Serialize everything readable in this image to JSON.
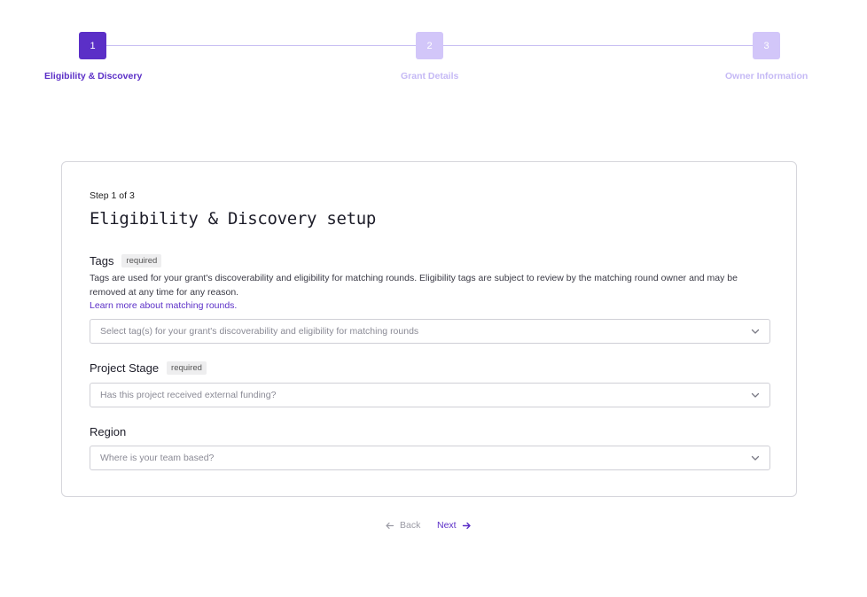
{
  "stepper": {
    "steps": [
      {
        "number": "1",
        "label": "Eligibility & Discovery",
        "state": "active"
      },
      {
        "number": "2",
        "label": "Grant Details",
        "state": "inactive"
      },
      {
        "number": "3",
        "label": "Owner Information",
        "state": "inactive"
      }
    ]
  },
  "card": {
    "step_count": "Step 1 of 3",
    "title": "Eligibility & Discovery setup",
    "tags": {
      "label": "Tags",
      "badge": "required",
      "help": "Tags are used for your grant's discoverability and eligibility for matching rounds. Eligibility tags are subject to review by the matching round owner and may be removed at any time for any reason.",
      "link": "Learn more about matching rounds.",
      "placeholder": "Select tag(s) for your grant's discoverability and eligibility for matching rounds"
    },
    "project_stage": {
      "label": "Project Stage",
      "badge": "required",
      "placeholder": "Has this project received external funding?"
    },
    "region": {
      "label": "Region",
      "placeholder": "Where is your team based?"
    }
  },
  "nav": {
    "back_label": "Back",
    "next_label": "Next"
  },
  "colors": {
    "accent": "#5b2fc7",
    "accent_light": "#d2c6f9",
    "border": "#d6d6dc"
  },
  "icons": [
    "chevron-down-icon",
    "arrow-left-icon",
    "arrow-right-icon"
  ]
}
